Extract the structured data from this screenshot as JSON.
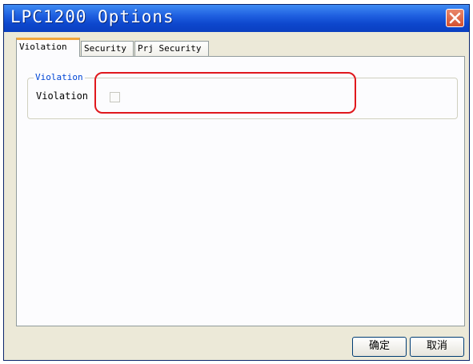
{
  "window": {
    "title": "LPC1200 Options",
    "close_icon": "close-icon"
  },
  "tabs": [
    {
      "label": "Violation",
      "active": true
    },
    {
      "label": "Security",
      "active": false
    },
    {
      "label": "Prj Security",
      "active": false
    }
  ],
  "violation_group": {
    "legend": "Violation",
    "field_label": "Violation",
    "checkbox_checked": false
  },
  "buttons": {
    "ok_label": "确定",
    "cancel_label": "取消"
  },
  "colors": {
    "title_bar": "#0d47cd",
    "highlight": "#e0181d",
    "group_legend": "#0046d5",
    "active_tab_accent": "#f0a53c"
  }
}
